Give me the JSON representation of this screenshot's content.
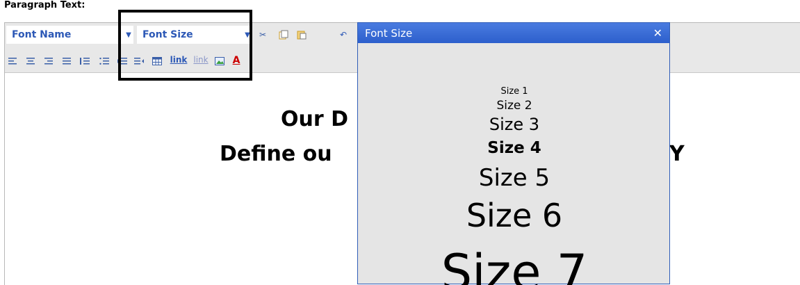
{
  "field_label": "Paragraph Text:",
  "toolbar": {
    "font_name_label": "Font Name",
    "font_size_label": "Font Size",
    "link_label": "link",
    "unlink_label": "link"
  },
  "content": {
    "line1": "Our D",
    "line2": "Define ou",
    "line2_tail": "Y"
  },
  "popup": {
    "title": "Font Size",
    "close": "✕",
    "options": [
      "Size 1",
      "Size 2",
      "Size 3",
      "Size 4",
      "Size 5",
      "Size 6",
      "Size 7"
    ]
  },
  "colors": {
    "accent": "#2c58b6",
    "popup_title_bg": "#2c5fcc",
    "toolbar_bg": "#e8e8e8",
    "popup_bg": "#e5e5e5",
    "highlight": "#000000"
  }
}
